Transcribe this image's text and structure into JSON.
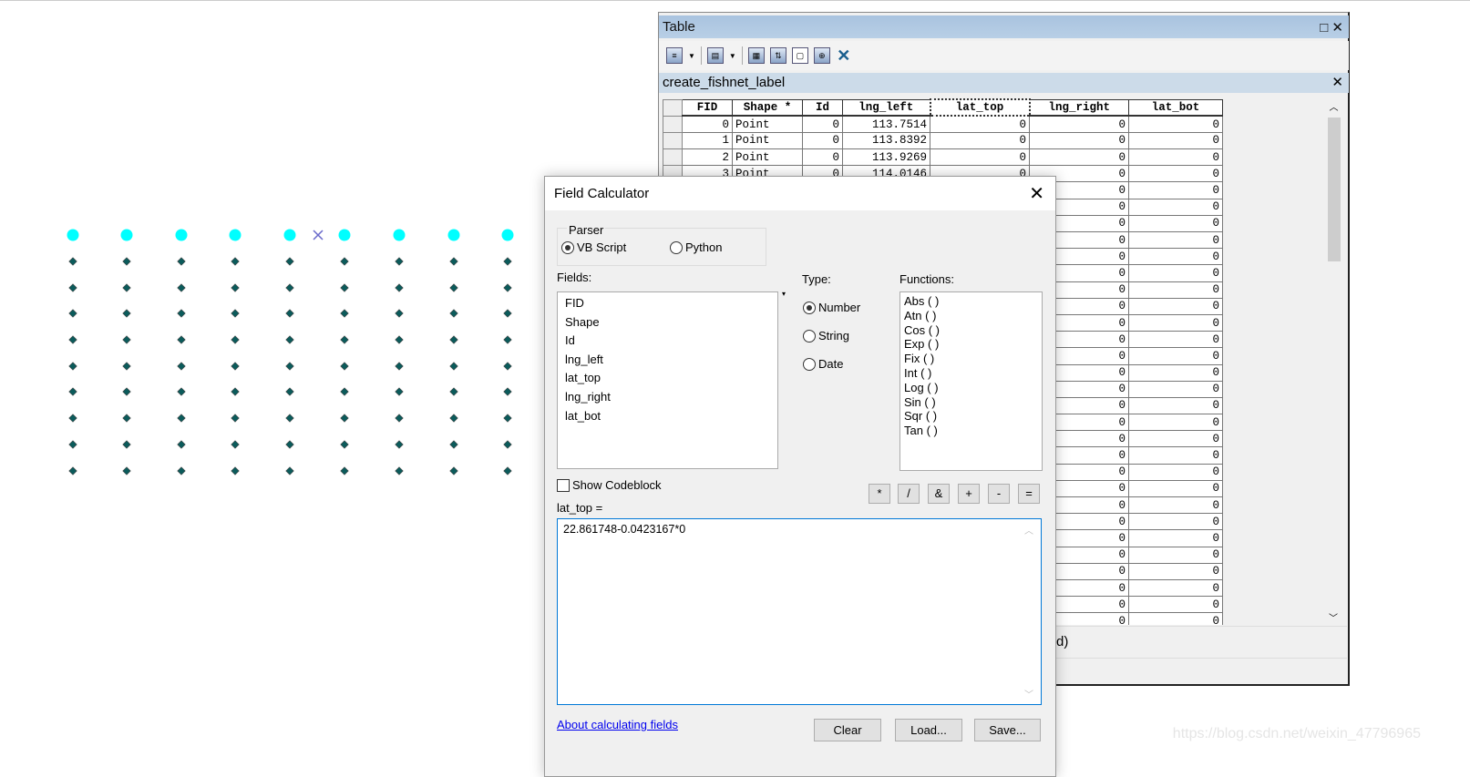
{
  "map": {
    "point_columns": 9,
    "label_point_rows": 1,
    "grid_point_rows": 9,
    "label_point_color": "#00ffff",
    "grid_point_color": "#0b5b5b",
    "cursor_icon": "x-cross-icon"
  },
  "table_window": {
    "title": "Table",
    "maximize_icon": "□",
    "close_icon": "✕",
    "toolbar": [
      "table-options",
      "related-tables",
      "select-by-attributes",
      "switch-selection",
      "clear-selection",
      "zoom-to-selected",
      "delete-selected"
    ],
    "layer_name": "create_fishnet_label",
    "columns": [
      "FID",
      "Shape *",
      "Id",
      "lng_left",
      "lat_top",
      "lng_right",
      "lat_bot"
    ],
    "selected_column": "lat_top",
    "rows": [
      [
        "0",
        "Point",
        "0",
        "113.7514",
        "0",
        "0",
        "0"
      ],
      [
        "1",
        "Point",
        "0",
        "113.8392",
        "0",
        "0",
        "0"
      ],
      [
        "2",
        "Point",
        "0",
        "113.9269",
        "0",
        "0",
        "0"
      ],
      [
        "3",
        "Point",
        "0",
        "114.0146",
        "0",
        "0",
        "0"
      ]
    ],
    "visible_tail_rows": 27,
    "tail_value": "0",
    "status_text": "d)"
  },
  "dialog": {
    "title": "Field Calculator",
    "close_icon": "✕",
    "parser_label": "Parser",
    "parser_options": [
      {
        "label": "VB Script",
        "selected": true
      },
      {
        "label": "Python",
        "selected": false
      }
    ],
    "fields_label": "Fields:",
    "fields": [
      "FID",
      "Shape",
      "Id",
      "lng_left",
      "lat_top",
      "lng_right",
      "lat_bot"
    ],
    "type_label": "Type:",
    "types": [
      {
        "label": "Number",
        "selected": true
      },
      {
        "label": "String",
        "selected": false
      },
      {
        "label": "Date",
        "selected": false
      }
    ],
    "functions_label": "Functions:",
    "functions": [
      "Abs ( )",
      "Atn ( )",
      "Cos ( )",
      "Exp ( )",
      "Fix ( )",
      "Int ( )",
      "Log ( )",
      "Sin ( )",
      "Sqr ( )",
      "Tan ( )"
    ],
    "show_codeblock": "Show Codeblock",
    "show_codeblock_checked": false,
    "operators": [
      "*",
      "/",
      "&",
      "+",
      "-",
      "="
    ],
    "expression_label": "lat_top =",
    "expression": "22.861748-0.0423167*0",
    "about_link": "About calculating fields",
    "clear": "Clear",
    "load": "Load...",
    "save": "Save..."
  },
  "watermark": "https://blog.csdn.net/weixin_47796965"
}
